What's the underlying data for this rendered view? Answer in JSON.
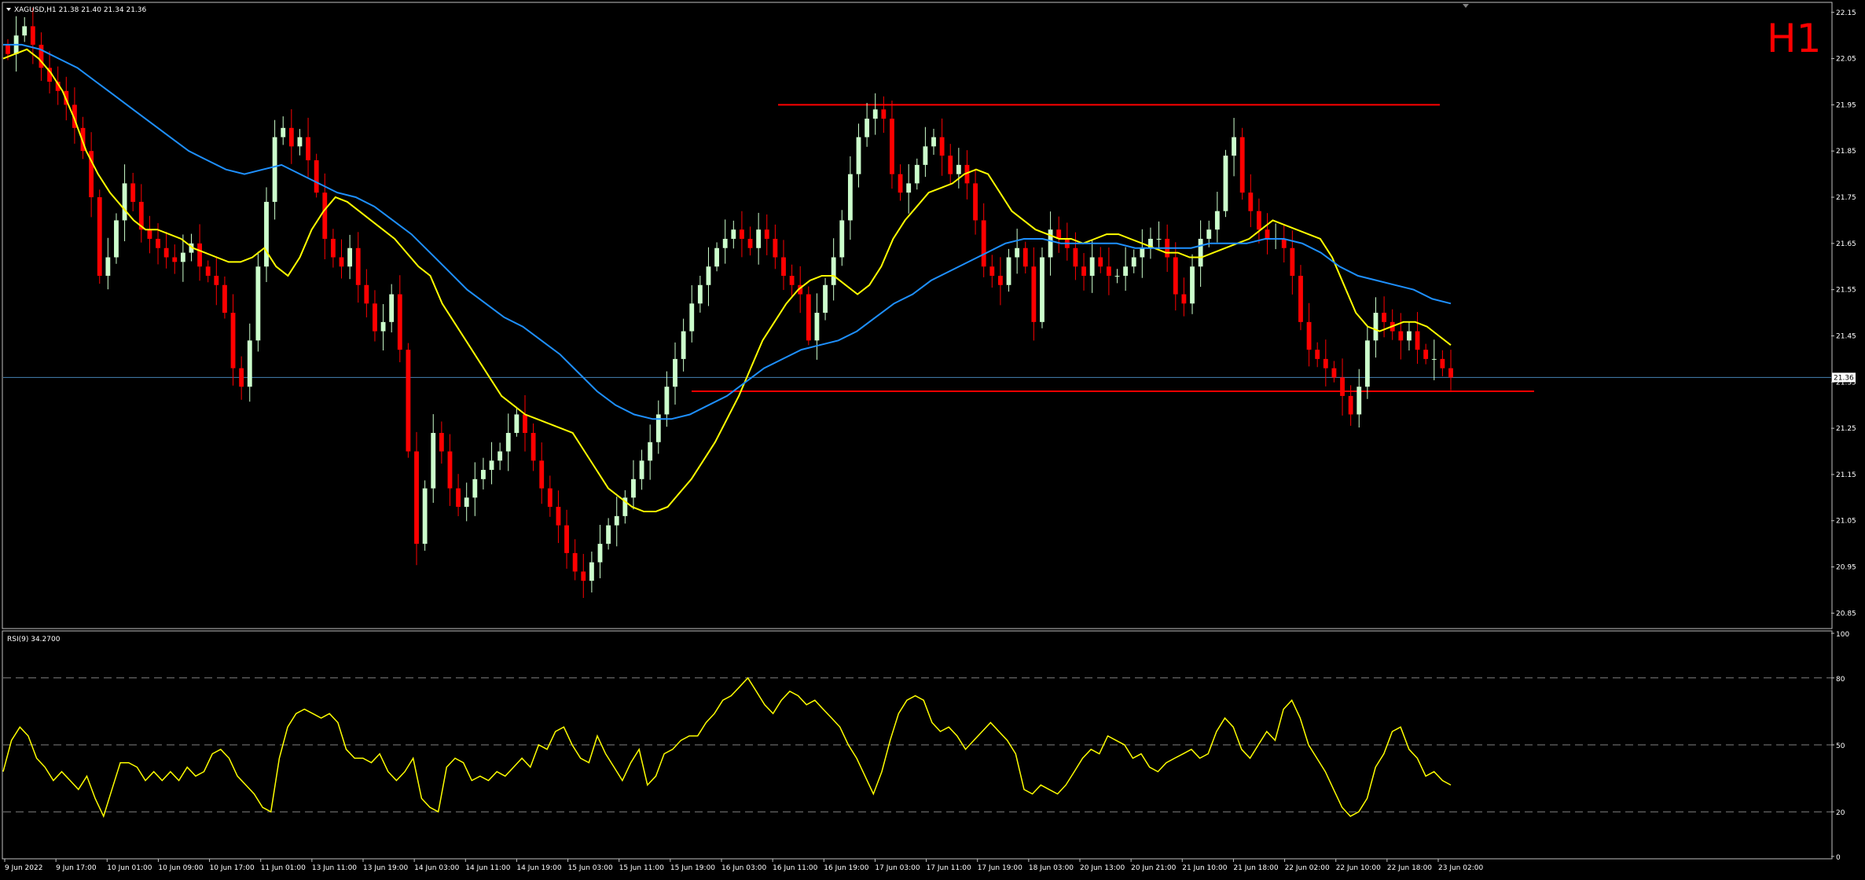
{
  "header": {
    "symbol_line": "XAGUSD,H1  21.38 21.40 21.34 21.36",
    "timeframe_label": "H1"
  },
  "colors": {
    "background": "#000000",
    "axis": "#c0c0c0",
    "text": "#ffffff",
    "bull_candle": "#ccffcc",
    "bear_candle": "#ff0000",
    "ma_fast": "#ffff00",
    "ma_slow": "#1e90ff",
    "level_lines": "#ff0000",
    "bid_line": "#4682b4",
    "rsi_line": "#ffff00",
    "rsi_levels": "#808080",
    "timeframe_label": "#ff0000"
  },
  "chart_data": [
    {
      "type": "candlestick",
      "symbol": "XAGUSD",
      "timeframe": "H1",
      "last_price": "21.36",
      "y_ticks": [
        "22.15",
        "22.05",
        "21.95",
        "21.85",
        "21.75",
        "21.65",
        "21.55",
        "21.45",
        "21.35",
        "21.25",
        "21.15",
        "21.05",
        "20.95",
        "20.85"
      ],
      "ylim": [
        20.82,
        22.17
      ],
      "x_ticks": [
        "9 Jun 2022",
        "9 Jun 17:00",
        "10 Jun 01:00",
        "10 Jun 09:00",
        "10 Jun 17:00",
        "11 Jun 01:00",
        "13 Jun 11:00",
        "13 Jun 19:00",
        "14 Jun 03:00",
        "14 Jun 11:00",
        "14 Jun 19:00",
        "15 Jun 03:00",
        "15 Jun 11:00",
        "15 Jun 19:00",
        "16 Jun 03:00",
        "16 Jun 11:00",
        "16 Jun 19:00",
        "17 Jun 03:00",
        "17 Jun 11:00",
        "17 Jun 19:00",
        "18 Jun 03:00",
        "20 Jun 13:00",
        "20 Jun 21:00",
        "21 Jun 10:00",
        "21 Jun 18:00",
        "22 Jun 02:00",
        "22 Jun 10:00",
        "22 Jun 18:00",
        "23 Jun 02:00"
      ],
      "resistance_level": 21.95,
      "support_level": 21.33,
      "bid_line": 21.36,
      "close_series": [
        22.06,
        22.1,
        22.12,
        22.08,
        22.03,
        22.0,
        21.98,
        21.95,
        21.9,
        21.85,
        21.75,
        21.58,
        21.62,
        21.7,
        21.78,
        21.74,
        21.68,
        21.66,
        21.64,
        21.62,
        21.61,
        21.63,
        21.65,
        21.6,
        21.58,
        21.56,
        21.5,
        21.38,
        21.34,
        21.44,
        21.6,
        21.74,
        21.88,
        21.9,
        21.86,
        21.88,
        21.83,
        21.76,
        21.66,
        21.62,
        21.6,
        21.64,
        21.56,
        21.52,
        21.46,
        21.48,
        21.54,
        21.42,
        21.2,
        21.0,
        21.12,
        21.24,
        21.2,
        21.12,
        21.08,
        21.1,
        21.14,
        21.16,
        21.18,
        21.2,
        21.24,
        21.28,
        21.24,
        21.18,
        21.12,
        21.08,
        21.04,
        20.98,
        20.94,
        20.92,
        20.96,
        21.0,
        21.04,
        21.06,
        21.1,
        21.14,
        21.18,
        21.22,
        21.28,
        21.34,
        21.4,
        21.46,
        21.52,
        21.56,
        21.6,
        21.64,
        21.66,
        21.68,
        21.66,
        21.64,
        21.68,
        21.66,
        21.62,
        21.58,
        21.56,
        21.54,
        21.44,
        21.5,
        21.56,
        21.62,
        21.7,
        21.8,
        21.88,
        21.92,
        21.94,
        21.92,
        21.8,
        21.76,
        21.78,
        21.82,
        21.86,
        21.88,
        21.84,
        21.8,
        21.82,
        21.78,
        21.7,
        21.6,
        21.58,
        21.56,
        21.62,
        21.64,
        21.6,
        21.48,
        21.62,
        21.68,
        21.66,
        21.64,
        21.6,
        21.58,
        21.62,
        21.6,
        21.58,
        21.58,
        21.6,
        21.62,
        21.64,
        21.66,
        21.66,
        21.62,
        21.54,
        21.52,
        21.6,
        21.66,
        21.68,
        21.72,
        21.84,
        21.88,
        21.76,
        21.72,
        21.68,
        21.66,
        21.66,
        21.64,
        21.58,
        21.48,
        21.42,
        21.4,
        21.38,
        21.36,
        21.32,
        21.28,
        21.34,
        21.44,
        21.5,
        21.48,
        21.46,
        21.44,
        21.46,
        21.42,
        21.4,
        21.4,
        21.38,
        21.36
      ],
      "series": [
        {
          "name": "MA fast",
          "values": [
            22.05,
            22.06,
            22.07,
            22.05,
            22.02,
            21.98,
            21.92,
            21.85,
            21.8,
            21.76,
            21.73,
            21.7,
            21.68,
            21.68,
            21.67,
            21.66,
            21.64,
            21.63,
            21.62,
            21.61,
            21.61,
            21.62,
            21.64,
            21.6,
            21.58,
            21.62,
            21.68,
            21.72,
            21.75,
            21.74,
            21.72,
            21.7,
            21.68,
            21.66,
            21.63,
            21.6,
            21.58,
            21.52,
            21.48,
            21.44,
            21.4,
            21.36,
            21.32,
            21.3,
            21.28,
            21.27,
            21.26,
            21.25,
            21.24,
            21.2,
            21.16,
            21.12,
            21.1,
            21.08,
            21.07,
            21.07,
            21.08,
            21.11,
            21.14,
            21.18,
            21.22,
            21.27,
            21.32,
            21.38,
            21.44,
            21.48,
            21.52,
            21.55,
            21.57,
            21.58,
            21.58,
            21.56,
            21.54,
            21.56,
            21.6,
            21.66,
            21.7,
            21.73,
            21.76,
            21.77,
            21.78,
            21.8,
            21.81,
            21.8,
            21.76,
            21.72,
            21.7,
            21.68,
            21.67,
            21.66,
            21.66,
            21.65,
            21.66,
            21.67,
            21.67,
            21.66,
            21.65,
            21.64,
            21.63,
            21.63,
            21.62,
            21.62,
            21.63,
            21.64,
            21.65,
            21.66,
            21.68,
            21.7,
            21.69,
            21.68,
            21.67,
            21.66,
            21.62,
            21.56,
            21.5,
            21.47,
            21.46,
            21.47,
            21.48,
            21.48,
            21.47,
            21.45,
            21.43
          ]
        },
        {
          "name": "MA slow",
          "values": [
            22.08,
            22.08,
            22.07,
            22.05,
            22.03,
            22.0,
            21.97,
            21.94,
            21.91,
            21.88,
            21.85,
            21.83,
            21.81,
            21.8,
            21.81,
            21.82,
            21.8,
            21.78,
            21.76,
            21.75,
            21.73,
            21.7,
            21.67,
            21.63,
            21.59,
            21.55,
            21.52,
            21.49,
            21.47,
            21.44,
            21.41,
            21.37,
            21.33,
            21.3,
            21.28,
            21.27,
            21.27,
            21.28,
            21.3,
            21.32,
            21.35,
            21.38,
            21.4,
            21.42,
            21.43,
            21.44,
            21.46,
            21.49,
            21.52,
            21.54,
            21.57,
            21.59,
            21.61,
            21.63,
            21.65,
            21.66,
            21.66,
            21.65,
            21.65,
            21.65,
            21.65,
            21.64,
            21.64,
            21.64,
            21.64,
            21.65,
            21.65,
            21.65,
            21.66,
            21.66,
            21.65,
            21.63,
            21.6,
            21.58,
            21.57,
            21.56,
            21.55,
            21.53,
            21.52
          ]
        }
      ]
    },
    {
      "type": "line",
      "indicator": "RSI(9)",
      "title": "RSI(9) 34.2700",
      "y_ticks": [
        "100",
        "80",
        "50",
        "20",
        "0"
      ],
      "ylim": [
        0,
        100
      ],
      "levels": [
        80,
        50,
        20
      ],
      "series": [
        {
          "values": [
            38,
            52,
            58,
            54,
            44,
            40,
            34,
            38,
            34,
            30,
            36,
            26,
            18,
            30,
            42,
            42,
            40,
            34,
            38,
            34,
            38,
            34,
            40,
            36,
            38,
            46,
            48,
            44,
            36,
            32,
            28,
            22,
            20,
            44,
            58,
            64,
            66,
            64,
            62,
            64,
            60,
            48,
            44,
            44,
            42,
            46,
            38,
            34,
            38,
            44,
            26,
            22,
            20,
            40,
            44,
            42,
            34,
            36,
            34,
            38,
            36,
            40,
            44,
            40,
            50,
            48,
            56,
            58,
            50,
            44,
            42,
            54,
            46,
            40,
            34,
            42,
            48,
            32,
            36,
            46,
            48,
            52,
            54,
            54,
            60,
            64,
            70,
            72,
            76,
            80,
            74,
            68,
            64,
            70,
            74,
            72,
            68,
            70,
            66,
            62,
            58,
            50,
            44,
            36,
            28,
            38,
            52,
            64,
            70,
            72,
            70,
            60,
            56,
            58,
            54,
            48,
            52,
            56,
            60,
            56,
            52,
            46,
            30,
            28,
            32,
            30,
            28,
            32,
            38,
            44,
            48,
            46,
            54,
            52,
            50,
            44,
            46,
            40,
            38,
            42,
            44,
            46,
            48,
            44,
            46,
            56,
            62,
            58,
            48,
            44,
            50,
            56,
            52,
            66,
            70,
            62,
            50,
            44,
            38,
            30,
            22,
            18,
            20,
            26,
            40,
            46,
            56,
            58,
            48,
            44,
            36,
            38,
            34,
            32
          ]
        }
      ]
    }
  ]
}
